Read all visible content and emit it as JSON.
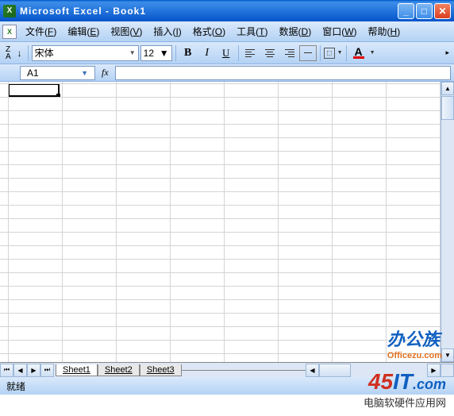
{
  "title": "Microsoft Excel - Book1",
  "menus": [
    {
      "label": "文件",
      "key": "F"
    },
    {
      "label": "编辑",
      "key": "E"
    },
    {
      "label": "视图",
      "key": "V"
    },
    {
      "label": "插入",
      "key": "I"
    },
    {
      "label": "格式",
      "key": "O"
    },
    {
      "label": "工具",
      "key": "T"
    },
    {
      "label": "数据",
      "key": "D"
    },
    {
      "label": "窗口",
      "key": "W"
    },
    {
      "label": "帮助",
      "key": "H"
    }
  ],
  "toolbar": {
    "sort_icons": "Z↓A↑",
    "font_name": "宋体",
    "font_size": "12",
    "bold": "B",
    "italic": "I",
    "underline": "U",
    "font_color": "A"
  },
  "formula": {
    "cell_ref": "A1",
    "fx": "fx",
    "value": ""
  },
  "sheets": {
    "tabs": [
      "Sheet1",
      "Sheet2",
      "Sheet3"
    ],
    "active": 0
  },
  "status": "就绪",
  "watermarks": {
    "w1": "办公族",
    "w1_sub": "Officezu.com",
    "w2_a": "45",
    "w2_b": "IT",
    "w2_c": ".com",
    "w2_tag": "电脑软硬件应用网"
  }
}
